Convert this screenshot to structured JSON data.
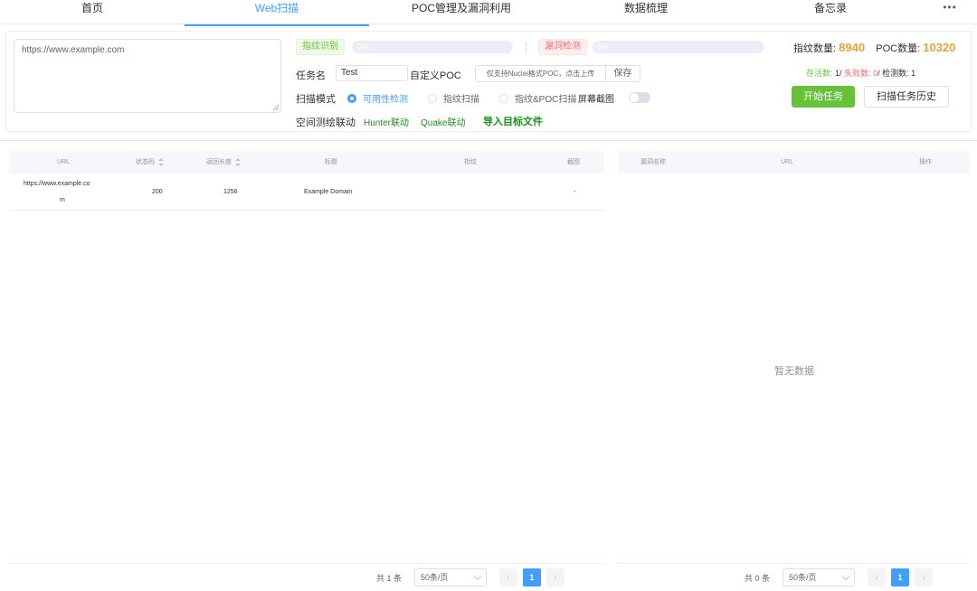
{
  "tabs": [
    {
      "label": "首页",
      "active": false
    },
    {
      "label": "Web扫描",
      "active": true
    },
    {
      "label": "POC管理及漏洞利用",
      "active": false
    },
    {
      "label": "数据梳理",
      "active": false
    },
    {
      "label": "备忘录",
      "active": false
    }
  ],
  "tabs_more": "•••",
  "config": {
    "url_input_value": "https://www.example.com",
    "fingerprint_tag": "指纹识别",
    "fingerprint_progress_text": "0%",
    "fingerprint_progress": 0,
    "vuln_tag": "漏洞检测",
    "vuln_progress_text": "0%",
    "vuln_progress": 0,
    "task_name_label": "任务名",
    "task_name_value": "Test",
    "custom_poc_label": "自定义POC",
    "upload_text": "仅支持Nuclei格式POC，点击上传",
    "save_label": "保存",
    "scan_mode_label": "扫描模式",
    "modes": [
      {
        "label": "可用性检测",
        "checked": true
      },
      {
        "label": "指纹扫描",
        "checked": false
      },
      {
        "label": "指纹&POC扫描",
        "checked": false
      }
    ],
    "screenshot_label": "屏幕截图",
    "screenshot_on": false,
    "space_label": "空间测绘联动",
    "hunter_link": "Hunter联动",
    "quake_link": "Quake联动",
    "import_link": "导入目标文件"
  },
  "counts": {
    "fingerprint_label": "指纹数量:",
    "fingerprint_value": "8940",
    "poc_label": "POC数量:",
    "poc_value": "10320",
    "alive_label": "存活数:",
    "alive_value": "1",
    "fail_label": "失败数:",
    "fail_value": "0",
    "checked_label": "检测数:",
    "checked_value": "1"
  },
  "buttons": {
    "start": "开始任务",
    "history": "扫描任务历史"
  },
  "left_table": {
    "columns": [
      "URL",
      "状态码",
      "返回长度",
      "标题",
      "指纹",
      "截图"
    ],
    "rows": [
      {
        "url_line1": "https://www.example.co",
        "url_line2": "m",
        "status": "200",
        "length": "1256",
        "title": "Example Domain",
        "fingerprint": "",
        "screenshot": "-"
      }
    ],
    "pager": {
      "total": "共 1 条",
      "size": "50条/页",
      "page": "1"
    }
  },
  "right_table": {
    "columns": [
      "漏洞名称",
      "URL",
      "操作"
    ],
    "empty_text": "暂无数据",
    "pager": {
      "total": "共 0 条",
      "size": "50条/页",
      "page": "1"
    }
  },
  "colors": {
    "primary": "#409eff",
    "success": "#67c23a",
    "danger": "#f56c6c",
    "warning": "#e6a23c"
  }
}
